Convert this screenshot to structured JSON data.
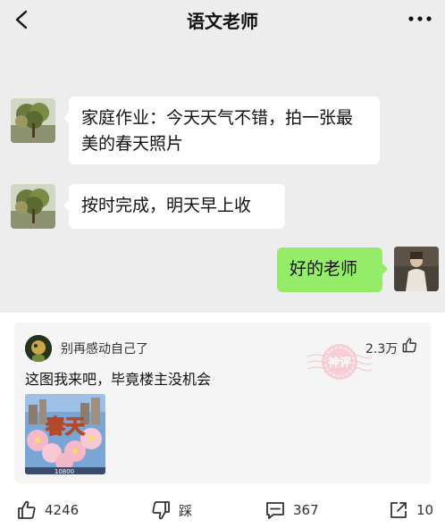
{
  "chat": {
    "title": "语文老师",
    "messages": [
      {
        "side": "left",
        "text": "家庭作业：今天天气不错，拍一张最美的春天照片"
      },
      {
        "side": "left",
        "text": "按时完成，明天早上收"
      },
      {
        "side": "right",
        "text": "好的老师"
      }
    ],
    "bubble_color_self": "#95ec69",
    "background": "#ededed"
  },
  "comment": {
    "username": "别再感动自己了",
    "likes": "2.3万",
    "text": "这图我来吧，毕竟楼主没机会",
    "badge_text": "神评",
    "image": {
      "big_text": "春天",
      "score": "10800"
    }
  },
  "actions": {
    "like_count": "4246",
    "dislike_label": "踩",
    "comment_count": "367",
    "share_count": "10"
  },
  "icons": [
    "back-icon",
    "more-icon",
    "thumb-up-icon",
    "thumb-down-icon",
    "comment-icon",
    "share-icon"
  ]
}
